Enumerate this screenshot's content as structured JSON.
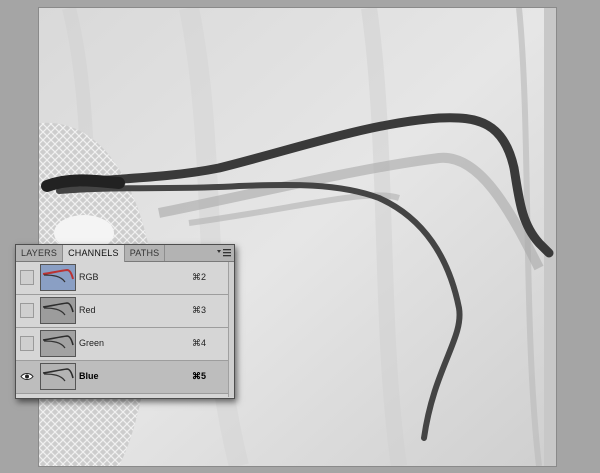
{
  "channels_panel": {
    "tabs": [
      {
        "label": "LAYERS",
        "active": false
      },
      {
        "label": "CHANNELS",
        "active": true
      },
      {
        "label": "PATHS",
        "active": false
      }
    ],
    "channels": [
      {
        "name": "RGB",
        "shortcut": "⌘2",
        "visible": false,
        "selected": false
      },
      {
        "name": "Red",
        "shortcut": "⌘3",
        "visible": false,
        "selected": false
      },
      {
        "name": "Green",
        "shortcut": "⌘4",
        "visible": false,
        "selected": false
      },
      {
        "name": "Blue",
        "shortcut": "⌘5",
        "visible": true,
        "selected": true
      }
    ]
  },
  "colors": {
    "workspace": "#a5a5a5",
    "panel_bg": "#d6d6d6",
    "selected_row": "#bdbdbd"
  }
}
